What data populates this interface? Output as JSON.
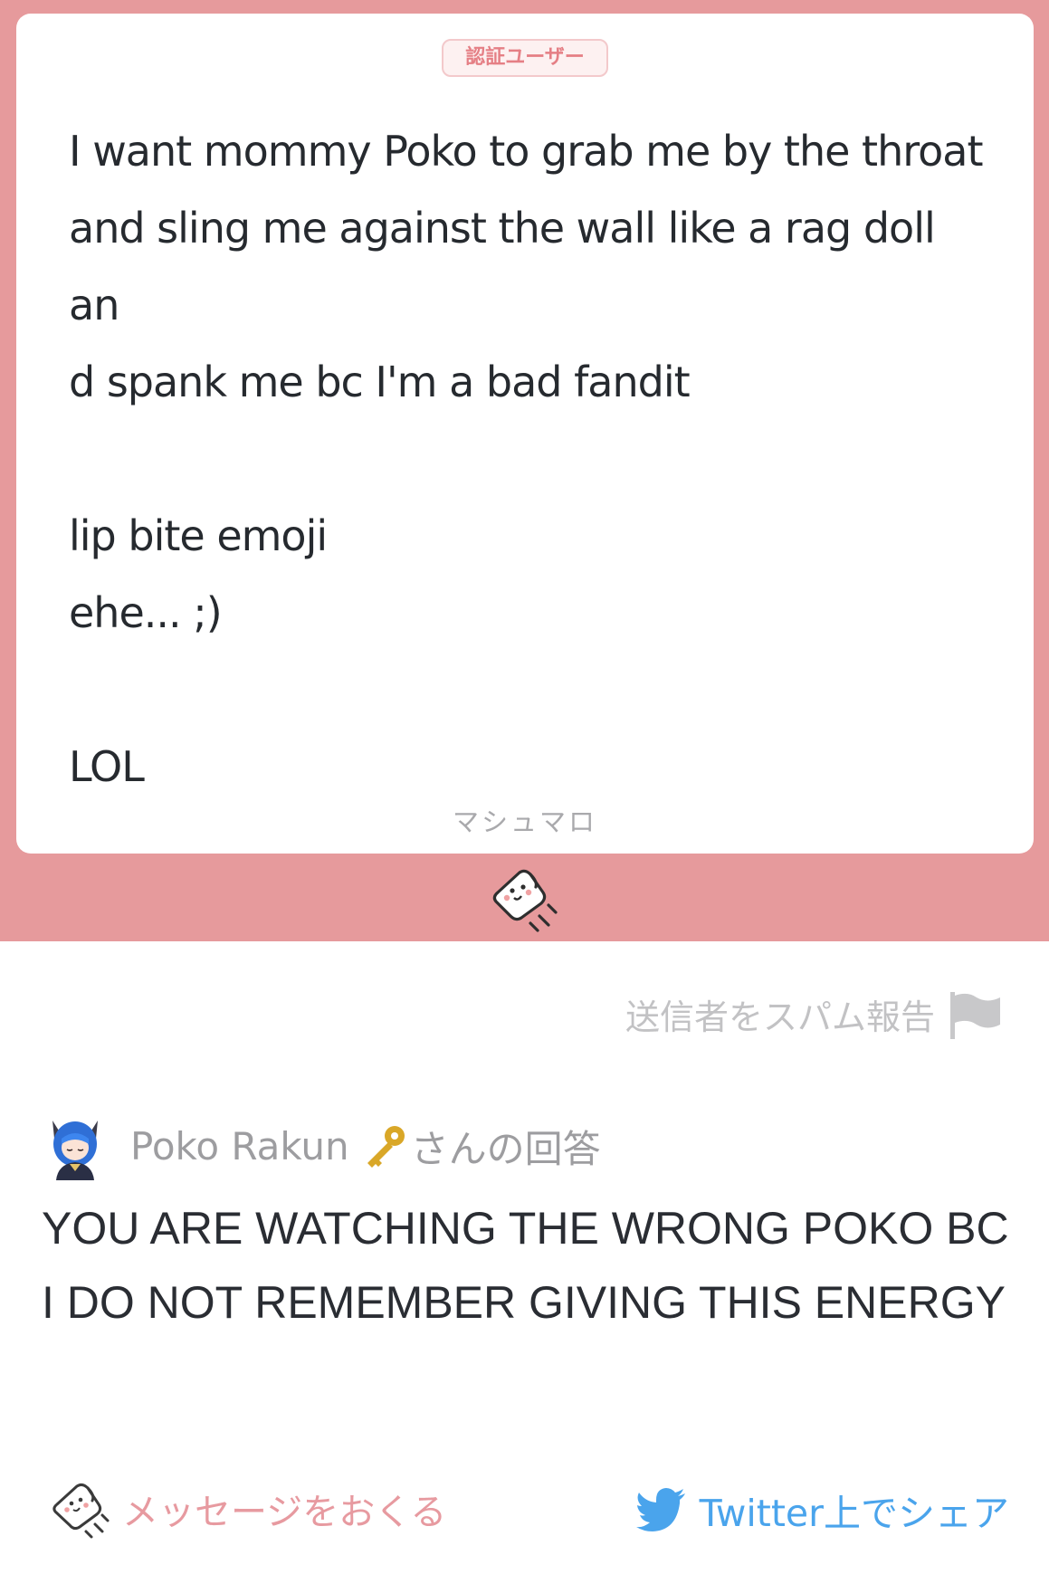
{
  "card": {
    "badge": "認証ユーザー",
    "message": "I want mommy Poko to grab me by the throat\nand sling me against the wall like a rag doll an\nd spank me bc I'm a bad fandit\n\nlip bite emoji\nehe... ;)\n\nLOL",
    "footer": "マシュマロ"
  },
  "spam_report": {
    "label": "送信者をスパム報告"
  },
  "answer": {
    "author": "Poko Rakun ",
    "suffix": "さんの回答",
    "text": "YOU ARE WATCHING THE WRONG POKO BC I DO NOT REMEMBER GIVING THIS ENERGY"
  },
  "actions": {
    "send_message": "メッセージをおくる",
    "share_twitter": "Twitter上でシェア"
  },
  "colors": {
    "brand_pink": "#e69a9c",
    "twitter_blue": "#4aa4ec"
  },
  "icons": [
    "marshmallow-icon",
    "flag-icon",
    "avatar",
    "key-icon",
    "twitter-icon"
  ]
}
